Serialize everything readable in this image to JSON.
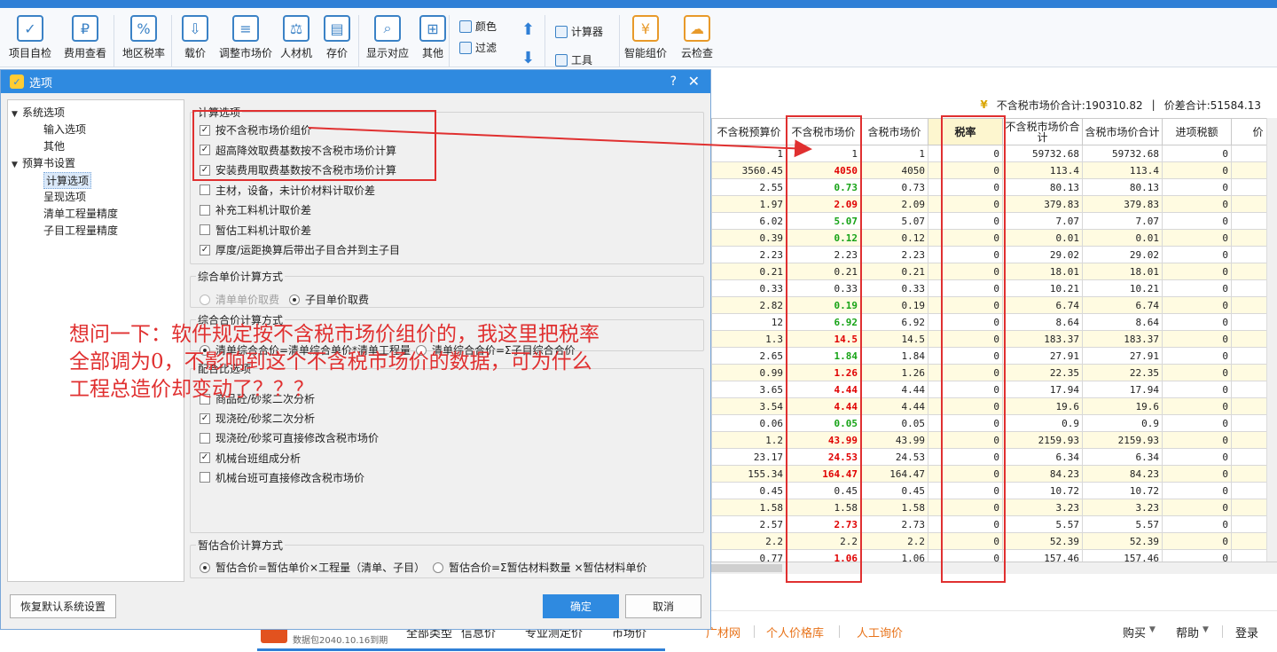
{
  "ribbon": {
    "buttons": [
      {
        "label": "项目自检",
        "icon": "checklist-icon"
      },
      {
        "label": "费用查看",
        "icon": "cost-view-icon"
      },
      {
        "label": "地区税率",
        "icon": "tax-rate-icon"
      },
      {
        "label": "载价",
        "icon": "load-price-icon"
      },
      {
        "label": "调整市场价",
        "icon": "adjust-price-icon"
      },
      {
        "label": "人材机",
        "icon": "scale-icon"
      },
      {
        "label": "存价",
        "icon": "save-price-icon"
      },
      {
        "label": "显示对应",
        "icon": "display-icon"
      },
      {
        "label": "其他",
        "icon": "grid-icon"
      }
    ],
    "small": {
      "color": "颜色",
      "filter": "过滤",
      "calculator": "计算器",
      "tools": "工具"
    },
    "right": [
      {
        "label": "智能组价",
        "icon": "smart-price-icon"
      },
      {
        "label": "云检查",
        "icon": "cloud-check-icon"
      }
    ]
  },
  "summary": {
    "untaxed_total": "不含税市场价合计:190310.82",
    "diff_total": "价差合计:51584.13"
  },
  "sheet": {
    "headers": [
      "不含税预算价",
      "不含税市场价",
      "含税市场价",
      "税率",
      "不含税市场价合计",
      "含税市场价合计",
      "进项税额",
      "价"
    ],
    "rows": [
      [
        "1",
        "1",
        "1",
        "0",
        "59732.68",
        "59732.68",
        "0"
      ],
      [
        "3560.45",
        "4050",
        "4050",
        "0",
        "113.4",
        "113.4",
        "0"
      ],
      [
        "2.55",
        "0.73",
        "0.73",
        "0",
        "80.13",
        "80.13",
        "0"
      ],
      [
        "1.97",
        "2.09",
        "2.09",
        "0",
        "379.83",
        "379.83",
        "0"
      ],
      [
        "6.02",
        "5.07",
        "5.07",
        "0",
        "7.07",
        "7.07",
        "0"
      ],
      [
        "0.39",
        "0.12",
        "0.12",
        "0",
        "0.01",
        "0.01",
        "0"
      ],
      [
        "2.23",
        "2.23",
        "2.23",
        "0",
        "29.02",
        "29.02",
        "0"
      ],
      [
        "0.21",
        "0.21",
        "0.21",
        "0",
        "18.01",
        "18.01",
        "0"
      ],
      [
        "0.33",
        "0.33",
        "0.33",
        "0",
        "10.21",
        "10.21",
        "0"
      ],
      [
        "2.82",
        "0.19",
        "0.19",
        "0",
        "6.74",
        "6.74",
        "0"
      ],
      [
        "12",
        "6.92",
        "6.92",
        "0",
        "8.64",
        "8.64",
        "0"
      ],
      [
        "1.3",
        "14.5",
        "14.5",
        "0",
        "183.37",
        "183.37",
        "0"
      ],
      [
        "2.65",
        "1.84",
        "1.84",
        "0",
        "27.91",
        "27.91",
        "0"
      ],
      [
        "0.99",
        "1.26",
        "1.26",
        "0",
        "22.35",
        "22.35",
        "0"
      ],
      [
        "3.65",
        "4.44",
        "4.44",
        "0",
        "17.94",
        "17.94",
        "0"
      ],
      [
        "3.54",
        "4.44",
        "4.44",
        "0",
        "19.6",
        "19.6",
        "0"
      ],
      [
        "0.06",
        "0.05",
        "0.05",
        "0",
        "0.9",
        "0.9",
        "0"
      ],
      [
        "1.2",
        "43.99",
        "43.99",
        "0",
        "2159.93",
        "2159.93",
        "0"
      ],
      [
        "23.17",
        "24.53",
        "24.53",
        "0",
        "6.34",
        "6.34",
        "0"
      ],
      [
        "155.34",
        "164.47",
        "164.47",
        "0",
        "84.23",
        "84.23",
        "0"
      ],
      [
        "0.45",
        "0.45",
        "0.45",
        "0",
        "10.72",
        "10.72",
        "0"
      ],
      [
        "1.58",
        "1.58",
        "1.58",
        "0",
        "3.23",
        "3.23",
        "0"
      ],
      [
        "2.57",
        "2.73",
        "2.73",
        "0",
        "5.57",
        "5.57",
        "0"
      ],
      [
        "2.2",
        "2.2",
        "2.2",
        "0",
        "52.39",
        "52.39",
        "0"
      ],
      [
        "0.77",
        "1.06",
        "1.06",
        "0",
        "157.46",
        "157.46",
        "0"
      ]
    ],
    "market_price_colors": [
      "black",
      "red",
      "green",
      "red",
      "green",
      "green",
      "black",
      "black",
      "black",
      "green",
      "green",
      "red",
      "green",
      "red",
      "red",
      "red",
      "green",
      "red",
      "red",
      "red",
      "black",
      "black",
      "red",
      "black",
      "red"
    ]
  },
  "bottom": {
    "left_tag": "数据包2040.10.16到期",
    "items": [
      "全部类型",
      "信息价",
      "专业测定价",
      "市场价",
      "广材网",
      "个人价格库",
      "人工询价"
    ],
    "right": [
      "购买",
      "帮助",
      "登录"
    ]
  },
  "dialog": {
    "title": "选项",
    "help": "?",
    "close": "✕",
    "tree": [
      {
        "label": "系统选项",
        "level": 0,
        "expand": "▼"
      },
      {
        "label": "输入选项",
        "level": 1
      },
      {
        "label": "其他",
        "level": 1
      },
      {
        "label": "预算书设置",
        "level": 0,
        "expand": "▼"
      },
      {
        "label": "计算选项",
        "level": 1,
        "selected": true
      },
      {
        "label": "呈现选项",
        "level": 1
      },
      {
        "label": "清单工程量精度",
        "level": 1
      },
      {
        "label": "子目工程量精度",
        "level": 1
      }
    ],
    "calc_group": {
      "title": "计算选项",
      "options": [
        {
          "label": "按不含税市场价组价",
          "checked": true
        },
        {
          "label": "超高降效取费基数按不含税市场价计算",
          "checked": true
        },
        {
          "label": "安装费用取费基数按不含税市场价计算",
          "checked": true
        },
        {
          "label": "主材，设备，未计价材料计取价差",
          "checked": false
        },
        {
          "label": "补充工料机计取价差",
          "checked": false
        },
        {
          "label": "暂估工料机计取价差",
          "checked": false
        },
        {
          "label": "厚度/运距换算后带出子目合并到主子目",
          "checked": true
        }
      ]
    },
    "unit_price_group": {
      "title": "综合单价计算方式",
      "options": [
        {
          "label": "清单单价取费",
          "selected": false,
          "disabled": true
        },
        {
          "label": "子目单价取费",
          "selected": true
        }
      ]
    },
    "total_price_group": {
      "title": "综合合价计算方式",
      "options": [
        {
          "label": "清单综合合价=清单综合单价*清单工程量",
          "selected": true
        },
        {
          "label": "清单综合合价=Σ子目综合合价",
          "selected": false
        }
      ]
    },
    "mix_group": {
      "title": "配合比选项",
      "options": [
        {
          "label": "商品砼/砂浆二次分析",
          "checked": false
        },
        {
          "label": "现浇砼/砂浆二次分析",
          "checked": true
        },
        {
          "label": "现浇砼/砂浆可直接修改含税市场价",
          "checked": false
        },
        {
          "label": "机械台班组成分析",
          "checked": true
        },
        {
          "label": "机械台班可直接修改含税市场价",
          "checked": false
        }
      ]
    },
    "estimate_group": {
      "title": "暂估合价计算方式",
      "options": [
        {
          "label": "暂估合价=暂估单价×工程量（清单、子目）",
          "selected": true
        },
        {
          "label": "暂估合价=Σ暂估材料数量 ×暂估材料单价",
          "selected": false
        }
      ]
    },
    "buttons": {
      "restore": "恢复默认系统设置",
      "ok": "确定",
      "cancel": "取消"
    }
  },
  "annotation": {
    "question_lines": [
      "想问一下：软件规定按不含税市场价组价的，我这里把税率",
      "全部调为0，不影响到这个不含税市场价的数据，可为什么",
      "工程总造价却变动了？？？"
    ],
    "color": "#e03030"
  }
}
